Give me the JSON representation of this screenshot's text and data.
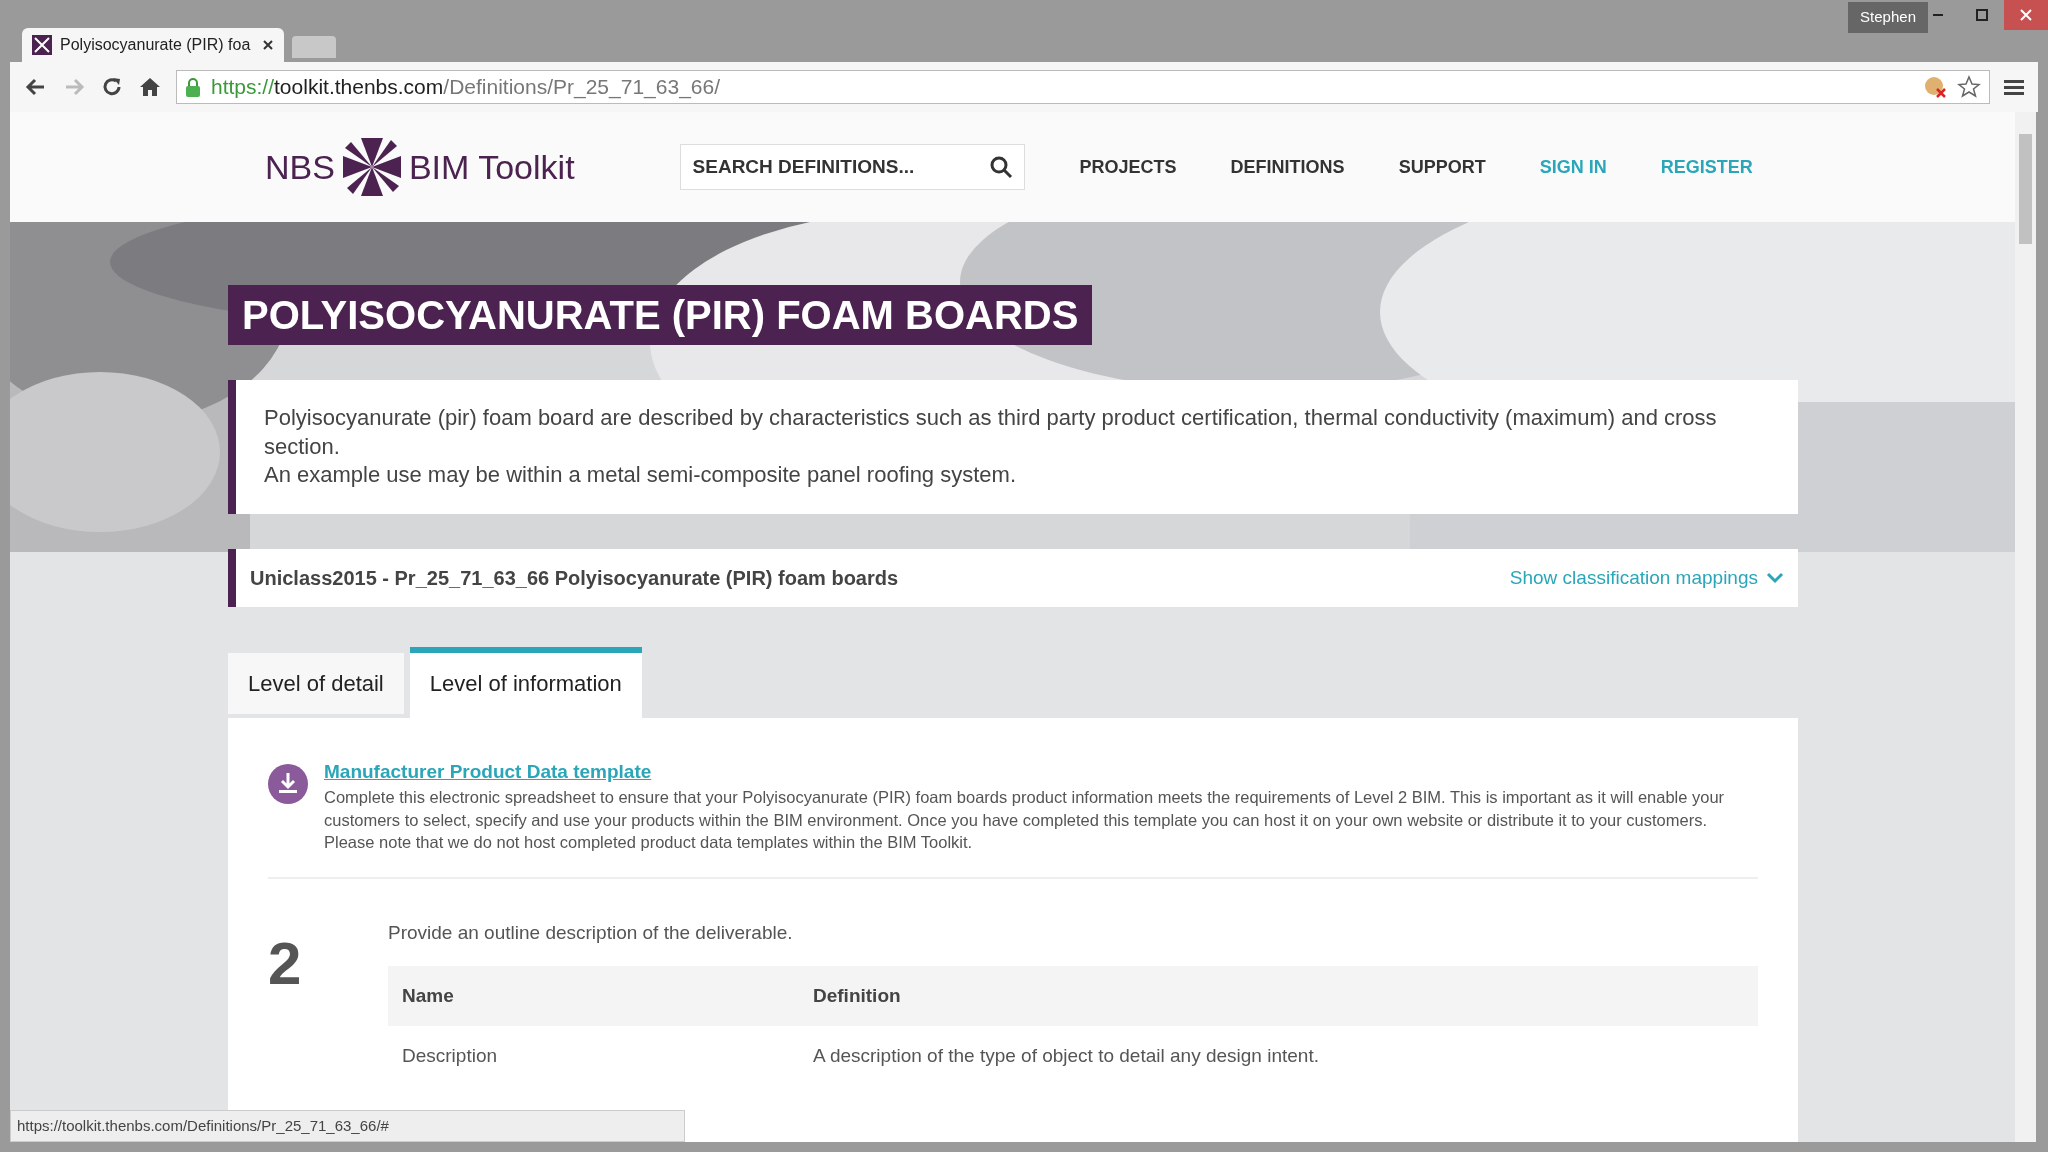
{
  "browser": {
    "tab_title": "Polyisocyanurate (PIR) foa",
    "url_scheme": "https://",
    "url_host": "toolkit.thenbs.com",
    "url_path": "/Definitions/Pr_25_71_63_66/",
    "user": "Stephen"
  },
  "header": {
    "logo_left": "NBS",
    "logo_right": "BIM Toolkit",
    "search": {
      "placeholder": "SEARCH DEFINITIONS..."
    },
    "nav": [
      {
        "label": "PROJECTS",
        "kind": "plain"
      },
      {
        "label": "DEFINITIONS",
        "kind": "plain"
      },
      {
        "label": "SUPPORT",
        "kind": "plain"
      },
      {
        "label": "SIGN IN",
        "kind": "account"
      },
      {
        "label": "REGISTER",
        "kind": "account"
      }
    ]
  },
  "page_title": "POLYISOCYANURATE (PIR) FOAM BOARDS",
  "description": [
    "Polyisocyanurate (pir) foam board are described by characteristics such as third party product certification, thermal conductivity (maximum) and cross section.",
    "An example use may be within a metal semi-composite panel roofing system."
  ],
  "classification": {
    "text": "Uniclass2015 - Pr_25_71_63_66 Polyisocyanurate (PIR) foam boards",
    "toggle": "Show classification mappings"
  },
  "tabs": [
    {
      "label": "Level of detail",
      "selected": false
    },
    {
      "label": "Level of information",
      "selected": true
    }
  ],
  "download": {
    "link": "Manufacturer Product Data template",
    "text": "Complete this electronic spreadsheet to ensure that your Polyisocyanurate (PIR) foam boards product information meets the requirements of Level 2 BIM. This is important as it will enable your customers to select, specify and use your products within the BIM environment. Once you have completed this template you can host it on your own website or distribute it to your customers. Please note that we do not host completed product data templates within the BIM Toolkit."
  },
  "step": {
    "number": "2",
    "prompt": "Provide an outline description of the deliverable.",
    "columns": [
      "Name",
      "Definition"
    ],
    "rows": [
      [
        "Description",
        "A description of the type of object to detail any design intent."
      ]
    ]
  },
  "status_bar": "https://toolkit.thenbs.com/Definitions/Pr_25_71_63_66/#"
}
